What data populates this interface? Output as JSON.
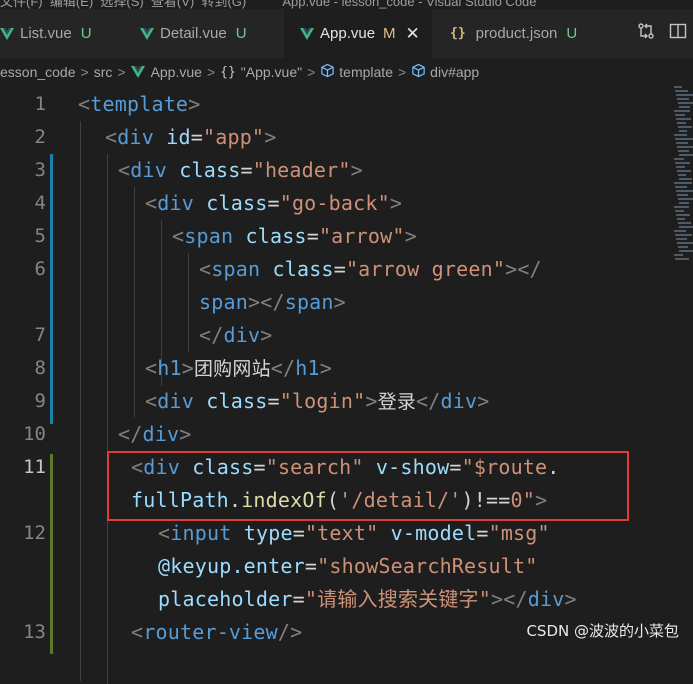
{
  "menubar": {
    "text": "文件(F)  编辑(E)  选择(S)  查看(V)  转到(G)          App.vue - lesson_code - Visual Studio Code"
  },
  "tabs": [
    {
      "label": "List.vue",
      "status": "U",
      "icon": "vue-icon"
    },
    {
      "label": "Detail.vue",
      "status": "U",
      "icon": "vue-icon"
    },
    {
      "label": "App.vue",
      "status": "M",
      "icon": "vue-icon",
      "active": true
    },
    {
      "label": "product.json",
      "status": "U",
      "icon": "json-icon",
      "icon_glyph": "{}"
    }
  ],
  "breadcrumb": {
    "items": [
      "esson_code",
      "src",
      "App.vue",
      "\"App.vue\"",
      "template",
      "div#app"
    ],
    "separator": ">"
  },
  "editor": {
    "line_numbers": [
      "1",
      "2",
      "3",
      "4",
      "5",
      "6",
      "",
      "7",
      "8",
      "9",
      "10",
      "11",
      "",
      "12",
      "",
      "",
      "13"
    ],
    "lines": [
      [
        "<",
        "template",
        ">"
      ],
      [
        "<",
        "div",
        " ",
        "id",
        "=",
        "\"app\"",
        ">"
      ],
      [
        "<",
        "div",
        " ",
        "class",
        "=",
        "\"header\"",
        ">"
      ],
      [
        "<",
        "div",
        " ",
        "class",
        "=",
        "\"go-back\"",
        ">"
      ],
      [
        "<",
        "span",
        " ",
        "class",
        "=",
        "\"arrow\"",
        ">"
      ],
      [
        "<",
        "span",
        " ",
        "class",
        "=",
        "\"arrow green\"",
        "></"
      ],
      [
        "span",
        "></",
        "span",
        ">"
      ],
      [
        "</",
        "div",
        ">"
      ],
      [
        "<",
        "h1",
        ">",
        "团购网站",
        "</",
        "h1",
        ">"
      ],
      [
        "<",
        "div",
        " ",
        "class",
        "=",
        "\"login\"",
        ">",
        "登录",
        "</",
        "div",
        ">"
      ],
      [
        "</",
        "div",
        ">"
      ],
      [
        "<",
        "div",
        " ",
        "class",
        "=",
        "\"search\"",
        " ",
        "v-show",
        "=",
        "\"",
        "$route",
        "."
      ],
      [
        "fullPath",
        ".",
        "indexOf",
        "(",
        "'/detail/'",
        ")",
        "!==",
        "0",
        "\"",
        ">"
      ],
      [
        "<",
        "input",
        " ",
        "type",
        "=",
        "\"text\"",
        " ",
        "v-model",
        "=",
        "\"msg\""
      ],
      [
        "@keyup.enter",
        "=",
        "\"showSearchResult\""
      ],
      [
        "placeholder",
        "=",
        "\"请输入搜索关键字\"",
        "></",
        "div",
        ">"
      ],
      [
        "<",
        "router-view",
        "/>"
      ]
    ]
  },
  "watermark": "CSDN @波波的小菜包",
  "colors": {
    "background": "#1e1e1e",
    "tag": "#569cd6",
    "attribute": "#9cdcfe",
    "string": "#ce9178",
    "bracket": "#808080",
    "function": "#dcdcaa",
    "highlight_box": "#e03a3a",
    "vue_green": "#41b883",
    "status_u": "#73c991",
    "status_m": "#e2c08d"
  }
}
